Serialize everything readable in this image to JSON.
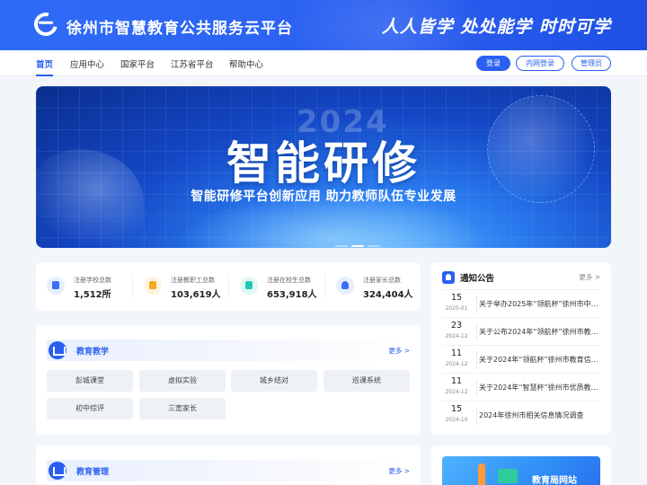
{
  "header": {
    "site_title": "徐州市智慧教育公共服务云平台",
    "slogan": "人人皆学 处处能学 时时可学"
  },
  "nav": {
    "items": [
      "首页",
      "应用中心",
      "国家平台",
      "江苏省平台",
      "帮助中心"
    ],
    "login": "登录",
    "intranet_login": "内网登录",
    "admin": "管理员"
  },
  "banner": {
    "year": "2024",
    "title": "智能研修",
    "subtitle": "智能研修平台创新应用 助力教师队伍专业发展"
  },
  "stats": [
    {
      "label": "注册学校总数",
      "value": "1,512所",
      "icon": "school-icon",
      "color": "#3b6ef5"
    },
    {
      "label": "注册教职工总数",
      "value": "103,619人",
      "icon": "teacher-cap-icon",
      "color": "#f5a623"
    },
    {
      "label": "注册在校生总数",
      "value": "653,918人",
      "icon": "student-icon",
      "color": "#1fc8b4"
    },
    {
      "label": "注册家长总数",
      "value": "324,404人",
      "icon": "parent-icon",
      "color": "#3b6ef5"
    }
  ],
  "teaching": {
    "title": "教育教学",
    "more": "更多 >",
    "tiles": [
      "彭城课堂",
      "虚拟实验",
      "城乡结对",
      "巡课系统",
      "初中综评",
      "三宽家长"
    ]
  },
  "management": {
    "title": "教育管理",
    "more": "更多 >"
  },
  "notice": {
    "title": "通知公告",
    "more": "更多 >",
    "items": [
      {
        "day": "15",
        "ym": "2025-01",
        "text": "关于举办2025年“领航杯”徐州市中…"
      },
      {
        "day": "23",
        "ym": "2024-12",
        "text": "关于公布2024年“领航杯”徐州市教…"
      },
      {
        "day": "11",
        "ym": "2024-12",
        "text": "关于2024年“领航杯”徐州市教育信…"
      },
      {
        "day": "11",
        "ym": "2024-12",
        "text": "关于2024年“智慧杯”徐州市优质教…"
      },
      {
        "day": "15",
        "ym": "2024-10",
        "text": "2024年徐州市相关信息情况调查"
      }
    ]
  },
  "edu_site": {
    "label": "教育局网站"
  },
  "colors": {
    "primary": "#2a5ff0",
    "background": "#f2f5fa"
  }
}
